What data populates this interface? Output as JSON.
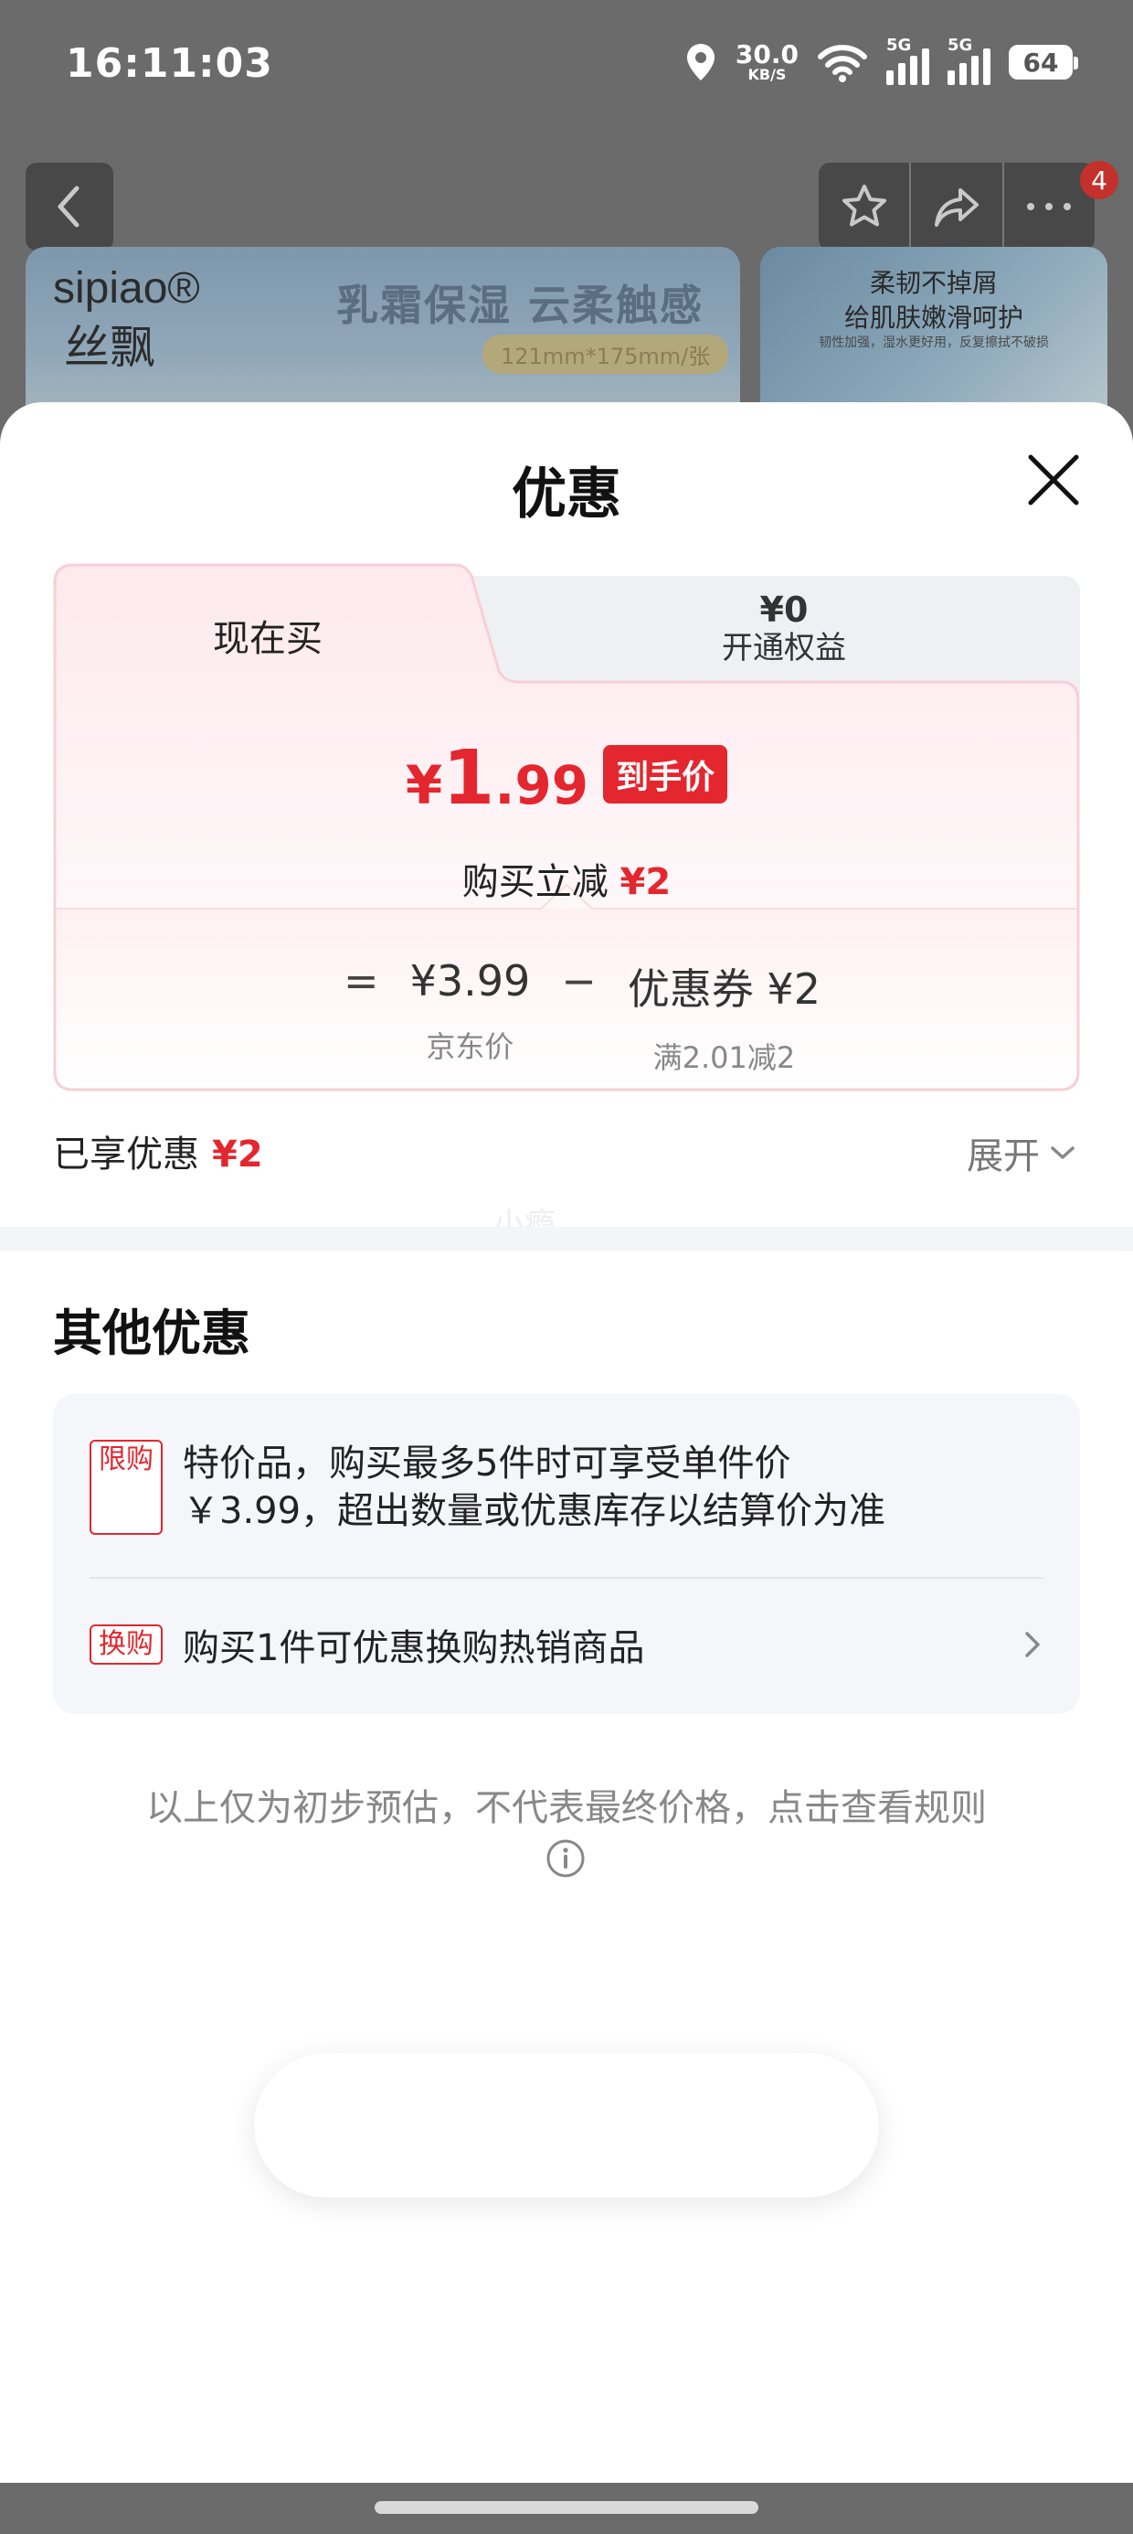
{
  "status_bar": {
    "time": "16:11:03",
    "net_speed_value": "30.0",
    "net_speed_unit": "KB/S",
    "signal1_label": "5G",
    "signal2_label": "5G",
    "battery": "64"
  },
  "header": {
    "notification_count": "4"
  },
  "banner": {
    "brand_en": "sipiao®",
    "brand_cn": "丝飘",
    "slogan": "乳霜保湿 云柔触感",
    "size": "121mm*175mm/张",
    "side_line1": "柔韧不掉屑",
    "side_line2": "给肌肤嫩滑呵护",
    "side_line3": "韧性加强，湿水更好用，反复擦拭不破损"
  },
  "sheet": {
    "title": "优惠",
    "tabs": {
      "now": "现在买",
      "member_price": "¥0",
      "member_label": "开通权益"
    },
    "price": {
      "currency": "¥",
      "integer": "1",
      "decimal": ".99",
      "tag": "到手价"
    },
    "reduction": {
      "label": "购买立减",
      "amount": "¥2"
    },
    "formula": {
      "equals": "=",
      "jd_price": "¥3.99",
      "jd_price_label": "京东价",
      "minus": "−",
      "coupon": "优惠券 ¥2",
      "coupon_rule": "满2.01减2"
    },
    "enjoyed": {
      "label": "已享优惠",
      "amount": "¥2"
    },
    "expand_label": "展开",
    "watermark": "小瘾",
    "other": {
      "title": "其他优惠",
      "items": [
        {
          "tag": "限购",
          "line1": "特价品，购买最多5件时可享受单件价",
          "line2": "￥3.99，超出数量或优惠库存以结算价为准"
        },
        {
          "tag": "换购",
          "text": "购买1件可优惠换购热销商品"
        }
      ]
    },
    "disclaimer": "以上仅为初步预估，不代表最终价格，点击查看规则"
  },
  "colors": {
    "accent_red": "#e4262f",
    "tab_border_pink": "#f7cfd6"
  }
}
